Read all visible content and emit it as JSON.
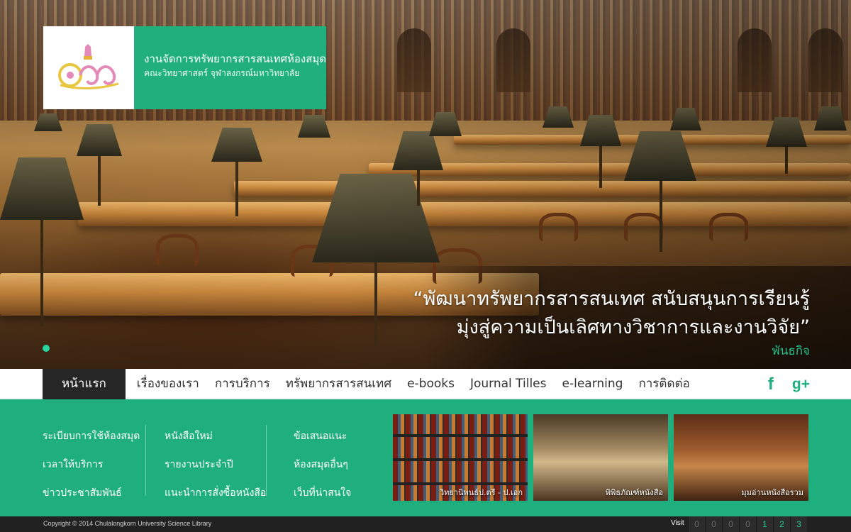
{
  "brand": {
    "title": "งานจัดการทรัพยากรสารสนเทศห้องสมุด",
    "subtitle": "คณะวิทยาศาสตร์ จุฬาลงกรณ์มหาวิทยาลัย",
    "logo_icon": "crown-emblem-icon"
  },
  "hero": {
    "quote_line1": "“พัฒนาทรัพยากรสารสนเทศ สนับสนุนการเรียนรู้",
    "quote_line2": "มุ่งสู่ความเป็นเลิศทางวิชาการและงานวิจัย”",
    "mission_link": "พันธกิจ",
    "active_slide": 1
  },
  "nav": {
    "items": [
      {
        "label": "หน้าแรก"
      },
      {
        "label": "เรื่องของเรา"
      },
      {
        "label": "การบริการ"
      },
      {
        "label": "ทรัพยากรสารสนเทศ"
      },
      {
        "label": "e-books"
      },
      {
        "label": "Journal Tilles"
      },
      {
        "label": "e-learning"
      },
      {
        "label": "การติดต่อ"
      }
    ],
    "social": {
      "facebook": "f",
      "googleplus": "g+"
    }
  },
  "links": {
    "col1": [
      "ระเบียบการใช้ห้องสมุด",
      "เวลาให้บริการ",
      "ข่าวประชาสัมพันธ์"
    ],
    "col2": [
      "หนังสือใหม่",
      "รายงานประจำปี",
      "แนะนำการสั่งซื้อหนังสือ"
    ],
    "col3": [
      "ข้อเสนอแนะ",
      "ห้องสมุดอื่นๆ",
      "เว็บที่น่าสนใจ"
    ]
  },
  "thumbs": [
    {
      "caption": "วิทยานิพนธ์ป.ตรี - ป.เอก"
    },
    {
      "caption": "พิพิธภัณฑ์หนังสือ"
    },
    {
      "caption": "มุมอ่านหนังสือรวม"
    }
  ],
  "footer": {
    "copyright": "Copyright © 2014 Chulalongkorn University Science Library",
    "visit_label": "Visit",
    "counter_digits": [
      "0",
      "0",
      "0",
      "0",
      "1",
      "2",
      "3"
    ]
  },
  "colors": {
    "accent": "#1fae7e",
    "nav_active_bg": "#262626",
    "footer_bg": "#212121"
  }
}
